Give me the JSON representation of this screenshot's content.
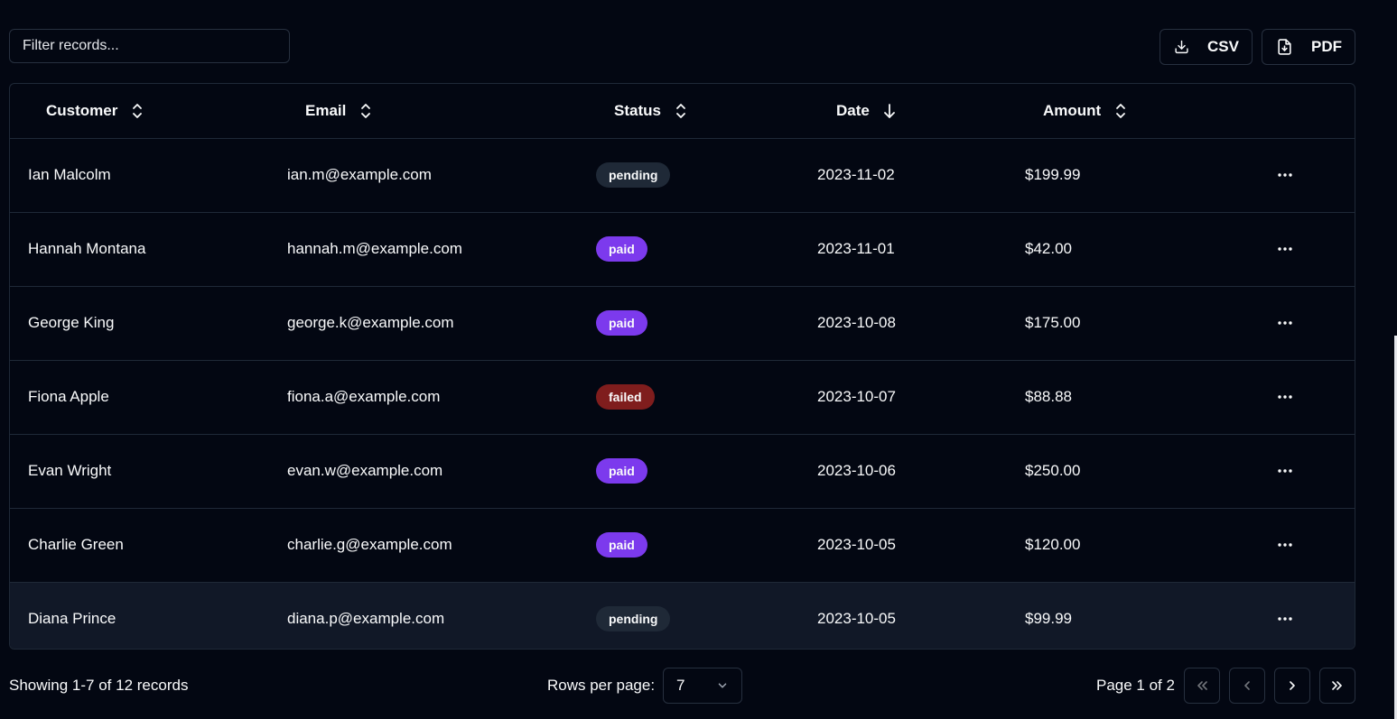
{
  "filter": {
    "placeholder": "Filter records..."
  },
  "export": {
    "csv_label": "CSV",
    "pdf_label": "PDF"
  },
  "columns": {
    "customer": "Customer",
    "email": "Email",
    "status": "Status",
    "date": "Date",
    "amount": "Amount"
  },
  "sort": {
    "active_column": "date",
    "direction": "descending"
  },
  "rows": [
    {
      "customer": "Ian Malcolm",
      "email": "ian.m@example.com",
      "status": "pending",
      "date": "2023-11-02",
      "amount": "$199.99"
    },
    {
      "customer": "Hannah Montana",
      "email": "hannah.m@example.com",
      "status": "paid",
      "date": "2023-11-01",
      "amount": "$42.00"
    },
    {
      "customer": "George King",
      "email": "george.k@example.com",
      "status": "paid",
      "date": "2023-10-08",
      "amount": "$175.00"
    },
    {
      "customer": "Fiona Apple",
      "email": "fiona.a@example.com",
      "status": "failed",
      "date": "2023-10-07",
      "amount": "$88.88"
    },
    {
      "customer": "Evan Wright",
      "email": "evan.w@example.com",
      "status": "paid",
      "date": "2023-10-06",
      "amount": "$250.00"
    },
    {
      "customer": "Charlie Green",
      "email": "charlie.g@example.com",
      "status": "paid",
      "date": "2023-10-05",
      "amount": "$120.00"
    },
    {
      "customer": "Diana Prince",
      "email": "diana.p@example.com",
      "status": "pending",
      "date": "2023-10-05",
      "amount": "$99.99"
    }
  ],
  "row_actions_icon": "ellipsis-horizontal-icon",
  "footer": {
    "showing_text": "Showing 1-7 of 12 records",
    "rows_per_page_label": "Rows per page:",
    "rows_per_page_value": "7",
    "page_text": "Page 1 of 2"
  },
  "colors": {
    "background": "#030712",
    "border": "#1f2937",
    "paid": "#7c3aed",
    "failed": "#7f1d1d",
    "pending": "#1f2937"
  }
}
